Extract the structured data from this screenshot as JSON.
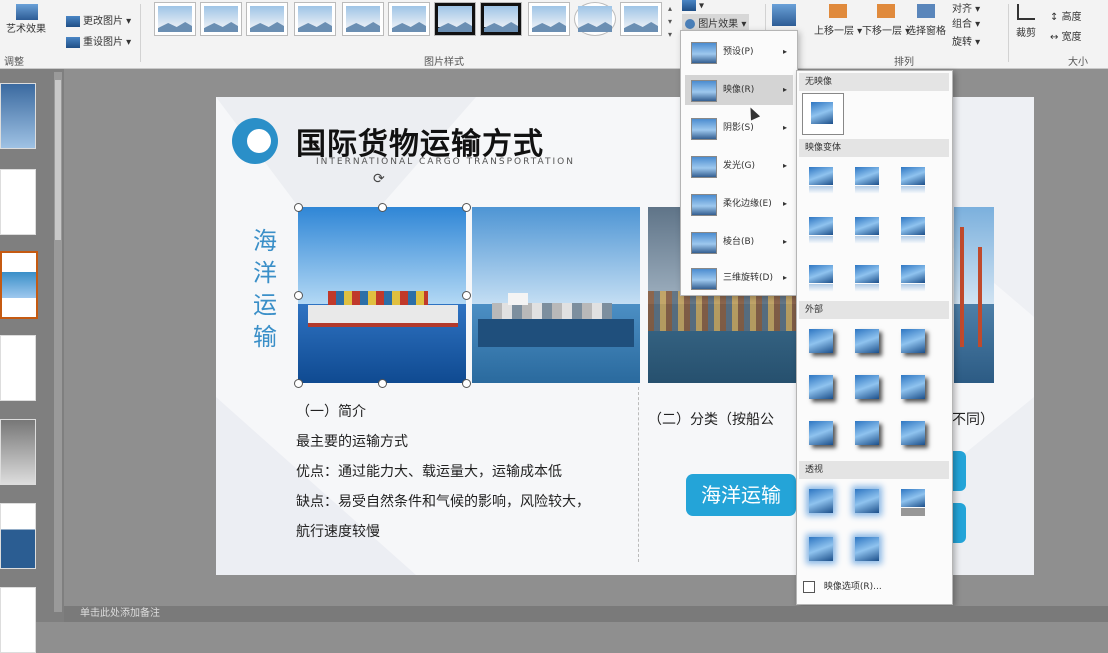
{
  "ribbon": {
    "adjust": {
      "b1": "艺术效果",
      "b2": "更改图片",
      "b3": "重设图片",
      "label": "调整"
    },
    "styles_label": "图片样式",
    "picture_effects_label": "图片效果",
    "arrange": {
      "bring_forward": "上移一层",
      "send_backward": "下移一层",
      "selection_pane": "选择窗格",
      "align": "对齐",
      "group": "组合",
      "rotate": "旋转",
      "label": "排列"
    },
    "size": {
      "crop": "裁剪",
      "height": "高度",
      "width": "宽度",
      "label": "大小"
    }
  },
  "slide": {
    "title": "国际货物运输方式",
    "subtitle": "INTERNATIONAL CARGO TRANSPORTATION",
    "vertical_label": "海洋运输",
    "intro_heading": "（一）简介",
    "line1": "最主要的运输方式",
    "line2": "优点：通过能力大、载运量大，运输成本低",
    "line3": "缺点：易受自然条件和气候的影响，风险较大，",
    "line4": "航行速度较慢",
    "classify": "（二）分类（按船公",
    "classify_tail": "不同）",
    "sea_button": "海洋运输"
  },
  "effects_menu": {
    "items": [
      {
        "label": "阴影(S)"
      },
      {
        "label": "映像(R)"
      },
      {
        "label": "发光(G)"
      },
      {
        "label": "柔化边缘(E)"
      },
      {
        "label": "棱台(B)"
      },
      {
        "label": "三维旋转(D)"
      }
    ],
    "first_item": "预设(P)"
  },
  "reflection_submenu": {
    "no_reflection": "无映像",
    "variant1": "映像变体",
    "variant2": "外部",
    "variant3": "透视",
    "options_checkbox": "映像选项(R)..."
  },
  "statusbar": {
    "text": "单击此处添加备注"
  }
}
